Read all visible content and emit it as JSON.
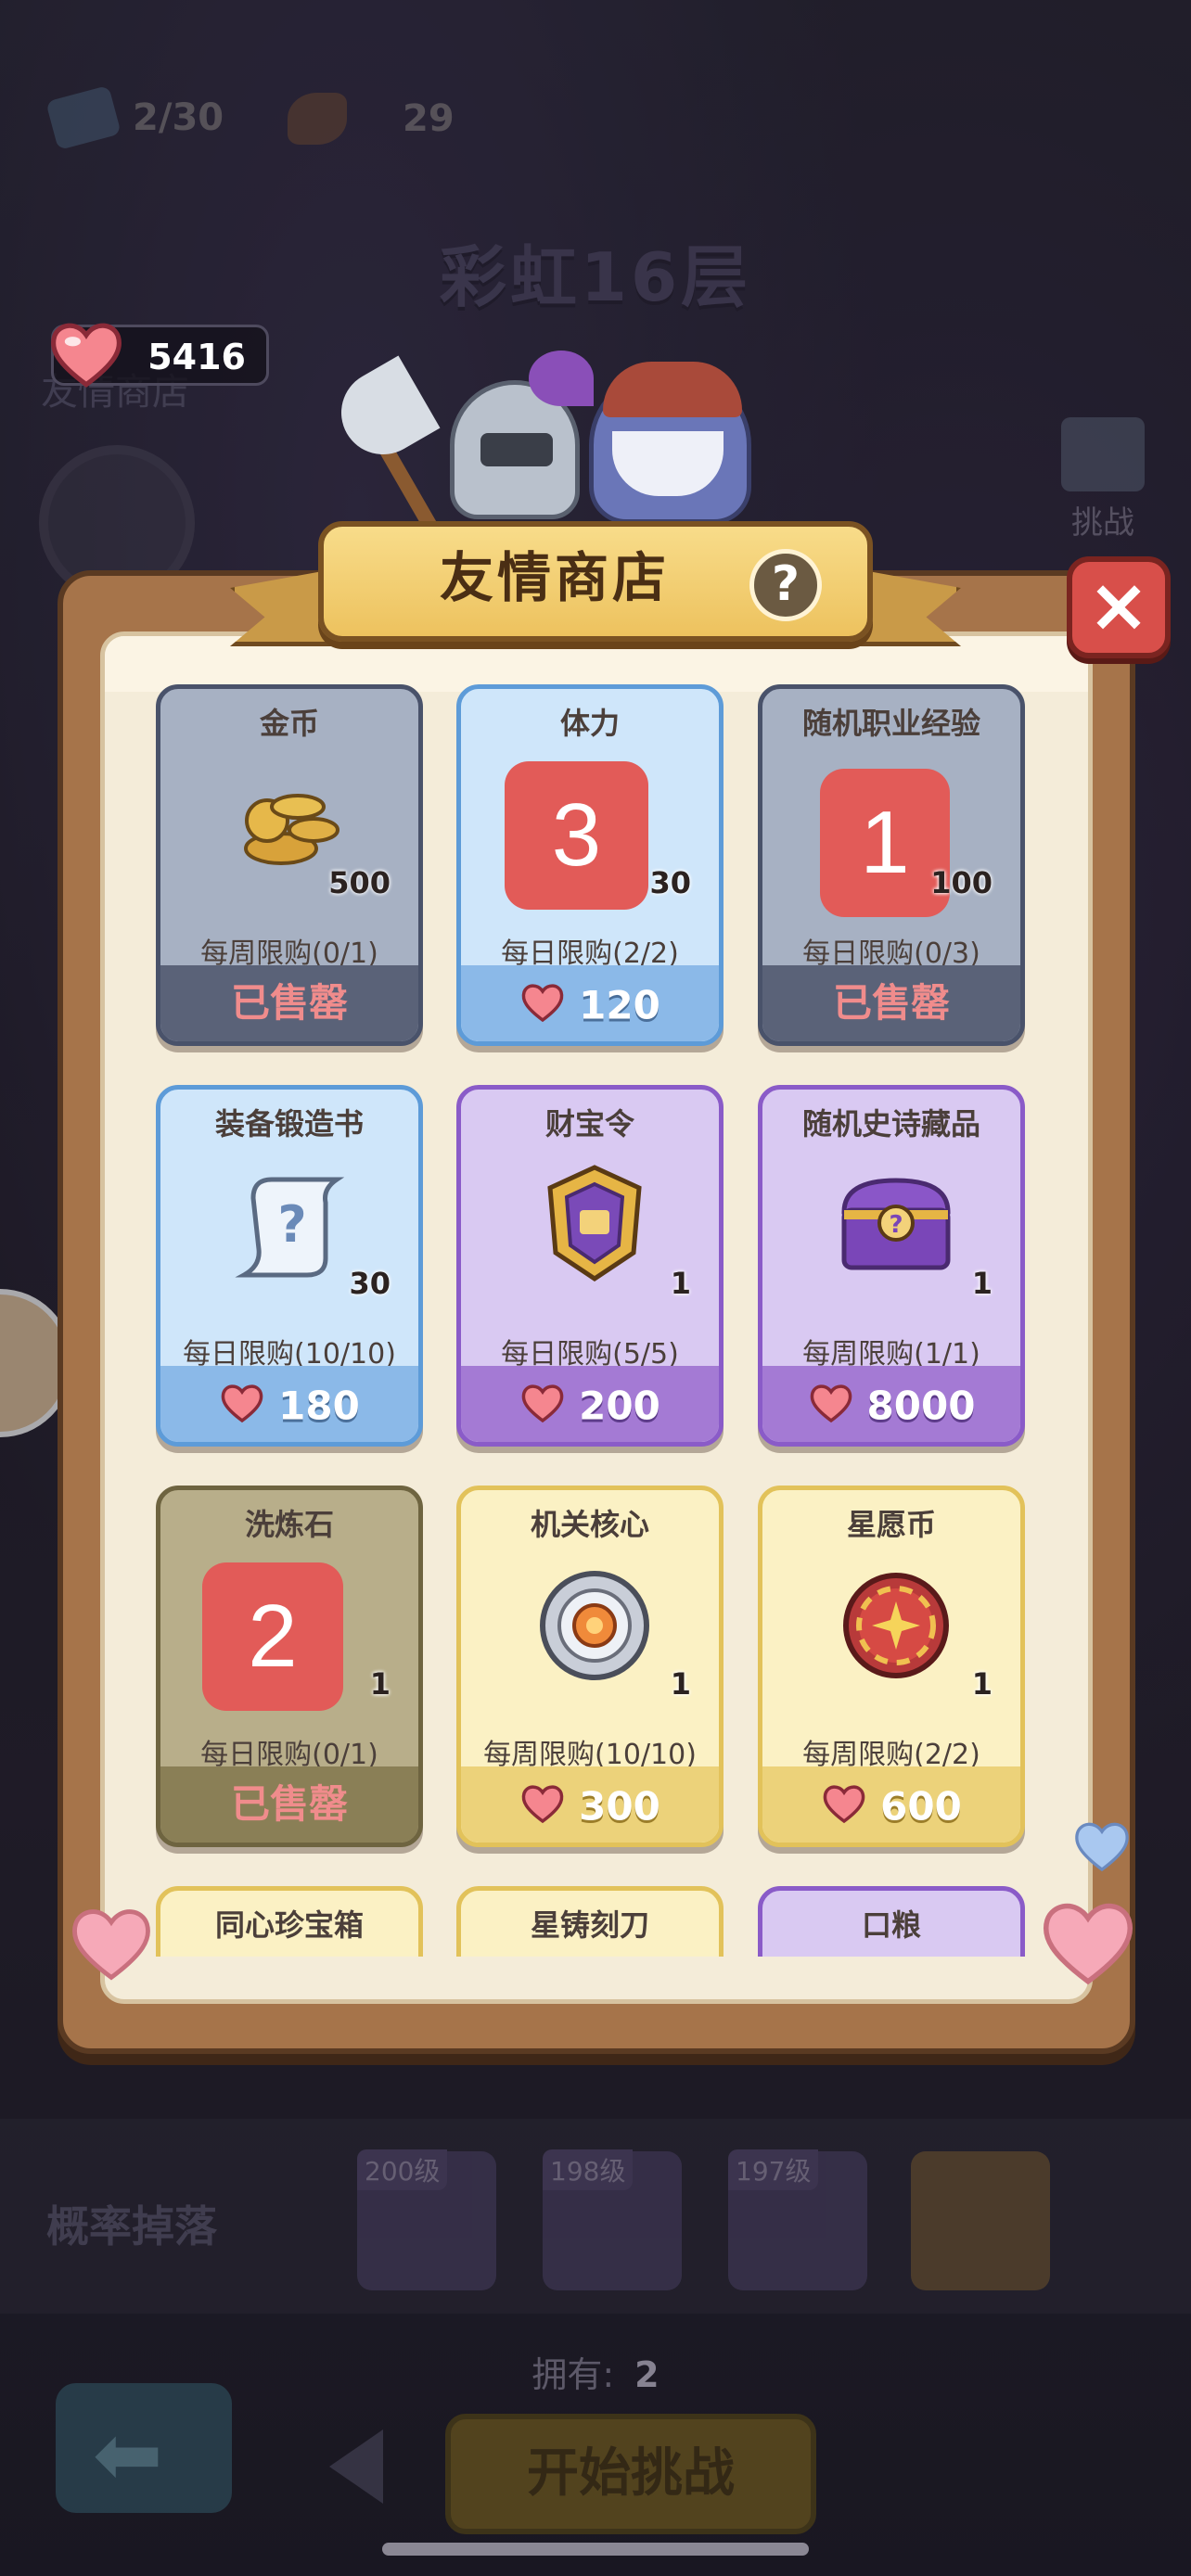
{
  "top_bar": {
    "tickets": "2/30",
    "stamina": "29",
    "floor_title": "彩虹16层",
    "friend_shop_side_label": "友情商店",
    "challenge_side_label": "挑战",
    "heart_count": "5416"
  },
  "shop": {
    "title": "友情商店",
    "help_label": "?",
    "close_label": "×",
    "items": [
      {
        "name": "金币",
        "qty": "500",
        "limit": "每周限购(0/1)",
        "price": "",
        "status": "已售罄",
        "theme": "gray",
        "icon": "gold-coins-icon"
      },
      {
        "name": "体力",
        "qty": "30",
        "limit": "每日限购(2/2)",
        "price": "120",
        "status": "",
        "theme": "blue",
        "icon": "stamina-meat-icon",
        "badge": "3"
      },
      {
        "name": "随机职业经验",
        "qty": "100",
        "limit": "每日限购(0/3)",
        "price": "",
        "status": "已售罄",
        "theme": "gray",
        "icon": "class-exp-icon",
        "badge": "1"
      },
      {
        "name": "装备锻造书",
        "qty": "30",
        "limit": "每日限购(10/10)",
        "price": "180",
        "status": "",
        "theme": "blue",
        "icon": "forge-scroll-icon"
      },
      {
        "name": "财宝令",
        "qty": "1",
        "limit": "每日限购(5/5)",
        "price": "200",
        "status": "",
        "theme": "purple",
        "icon": "treasure-token-icon"
      },
      {
        "name": "随机史诗藏品",
        "qty": "1",
        "limit": "每周限购(1/1)",
        "price": "8000",
        "status": "",
        "theme": "purple",
        "icon": "epic-chest-icon"
      },
      {
        "name": "洗炼石",
        "qty": "1",
        "limit": "每日限购(0/1)",
        "price": "",
        "status": "已售罄",
        "theme": "olive",
        "icon": "refine-stone-icon",
        "badge": "2"
      },
      {
        "name": "机关核心",
        "qty": "1",
        "limit": "每周限购(10/10)",
        "price": "300",
        "status": "",
        "theme": "yellow",
        "icon": "mech-core-icon"
      },
      {
        "name": "星愿币",
        "qty": "1",
        "limit": "每周限购(2/2)",
        "price": "600",
        "status": "",
        "theme": "yellow",
        "icon": "star-wish-coin-icon"
      },
      {
        "name": "同心珍宝箱",
        "theme": "yellow"
      },
      {
        "name": "星铸刻刀",
        "theme": "yellow"
      },
      {
        "name": "口粮",
        "theme": "purple"
      }
    ]
  },
  "bottom": {
    "drop_label": "概率掉落",
    "drops": [
      {
        "level": "200级",
        "icon": "purple-chest-icon"
      },
      {
        "level": "198级",
        "icon": "purple-armor-icon"
      },
      {
        "level": "197级",
        "icon": "purple-armor-icon"
      },
      {
        "level": "",
        "icon": "mystery-chest-icon"
      }
    ],
    "own_label": "拥有:",
    "own_count": "2",
    "start_label": "开始挑战",
    "back_arrow": "⬅"
  },
  "colors": {
    "heart": "#f5868f",
    "sold_out_text": "#f08c8c",
    "badge_red": "#e25b58",
    "frame": "#a6744a",
    "ribbon": "#edc25e"
  }
}
